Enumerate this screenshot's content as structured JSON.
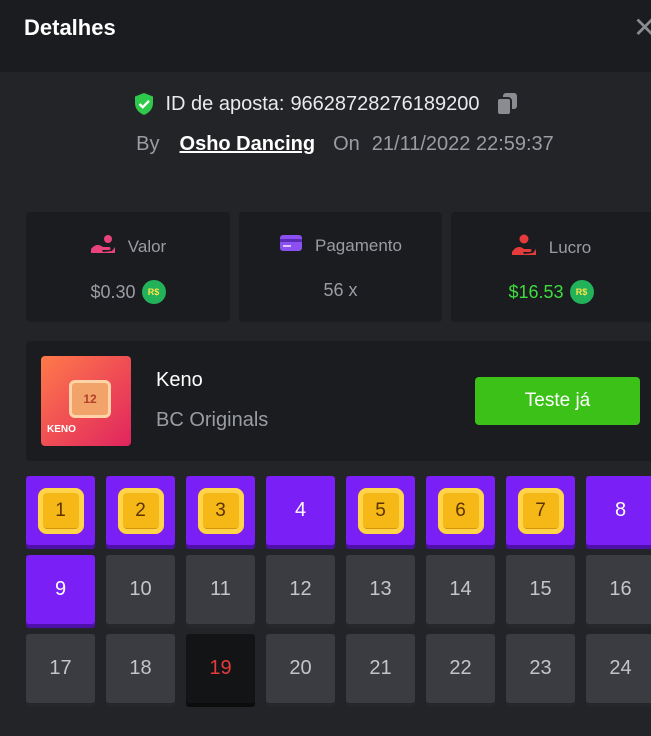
{
  "header": {
    "title": "Detalhes"
  },
  "bet": {
    "id_label": "ID de aposta:",
    "id_value": "96628728276189200",
    "by_label": "By",
    "user": "Osho Dancing",
    "on_label": "On",
    "datetime": "21/11/2022 22:59:37"
  },
  "stats": [
    {
      "label": "Valor",
      "value": "$0.30",
      "coin": "R$",
      "icon": "bet-hand-icon",
      "color": "#9a9ca3"
    },
    {
      "label": "Pagamento",
      "value": "56 x",
      "icon": "card-icon",
      "color": "#9a9ca3"
    },
    {
      "label": "Lucro",
      "value": "$16.53",
      "coin": "R$",
      "icon": "profit-hand-icon",
      "color": "#3ddc3d"
    }
  ],
  "game": {
    "name": "Keno",
    "provider": "BC Originals",
    "thumb_label": "KENO",
    "thumb_number": "12",
    "button": "Teste já"
  },
  "cells": [
    {
      "n": "1",
      "state": "gem"
    },
    {
      "n": "2",
      "state": "gem"
    },
    {
      "n": "3",
      "state": "gem"
    },
    {
      "n": "4",
      "state": "selected"
    },
    {
      "n": "5",
      "state": "gem"
    },
    {
      "n": "6",
      "state": "gem"
    },
    {
      "n": "7",
      "state": "gem"
    },
    {
      "n": "8",
      "state": "selected"
    },
    {
      "n": "9",
      "state": "selected"
    },
    {
      "n": "10",
      "state": "normal"
    },
    {
      "n": "11",
      "state": "normal"
    },
    {
      "n": "12",
      "state": "normal"
    },
    {
      "n": "13",
      "state": "normal"
    },
    {
      "n": "14",
      "state": "normal"
    },
    {
      "n": "15",
      "state": "normal"
    },
    {
      "n": "16",
      "state": "normal"
    },
    {
      "n": "17",
      "state": "normal"
    },
    {
      "n": "18",
      "state": "normal"
    },
    {
      "n": "19",
      "state": "drawn"
    },
    {
      "n": "20",
      "state": "normal"
    },
    {
      "n": "21",
      "state": "normal"
    },
    {
      "n": "22",
      "state": "normal"
    },
    {
      "n": "23",
      "state": "normal"
    },
    {
      "n": "24",
      "state": "normal"
    }
  ],
  "colors": {
    "accent": "#7a1ff5",
    "button": "#3bc117",
    "profit": "#3ddc3d",
    "gem": "#f5b816"
  }
}
